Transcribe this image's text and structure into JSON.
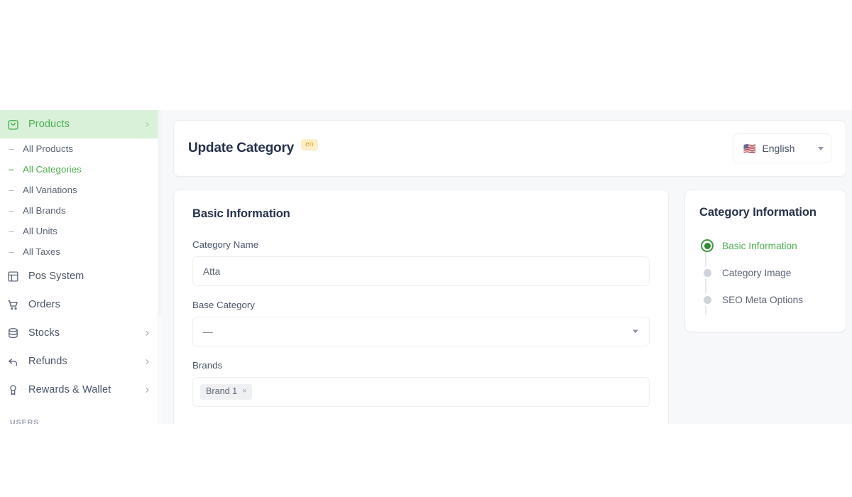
{
  "sidebar": {
    "groups": [
      {
        "label": "Products",
        "icon": "bag-icon",
        "active": true,
        "has_chevron": true,
        "children": [
          {
            "label": "All Products",
            "active": false
          },
          {
            "label": "All Categories",
            "active": true
          },
          {
            "label": "All Variations",
            "active": false
          },
          {
            "label": "All Brands",
            "active": false
          },
          {
            "label": "All Units",
            "active": false
          },
          {
            "label": "All Taxes",
            "active": false
          }
        ]
      },
      {
        "label": "Pos System",
        "icon": "layout-grid-icon",
        "active": false,
        "has_chevron": false,
        "children": []
      },
      {
        "label": "Orders",
        "icon": "cart-icon",
        "active": false,
        "has_chevron": false,
        "children": []
      },
      {
        "label": "Stocks",
        "icon": "database-icon",
        "active": false,
        "has_chevron": true,
        "children": []
      },
      {
        "label": "Refunds",
        "icon": "undo-arrow-icon",
        "active": false,
        "has_chevron": true,
        "children": []
      },
      {
        "label": "Rewards & Wallet",
        "icon": "award-icon",
        "active": false,
        "has_chevron": true,
        "children": []
      }
    ],
    "section_title": "USERS"
  },
  "header": {
    "title": "Update Category",
    "lang_badge": "en",
    "language_select": {
      "flag": "🇺🇸",
      "value": "English",
      "icon": "chevron-down-icon"
    }
  },
  "basic_information": {
    "heading": "Basic Information",
    "fields": {
      "category_name": {
        "label": "Category Name",
        "value": "Atta",
        "placeholder": "Category Name"
      },
      "base_category": {
        "label": "Base Category",
        "value": "—",
        "icon": "chevron-down-icon"
      },
      "brands": {
        "label": "Brands",
        "chips": [
          {
            "label": "Brand 1",
            "remove": "×"
          }
        ]
      }
    }
  },
  "category_information": {
    "heading": "Category Information",
    "steps": [
      {
        "label": "Basic Information",
        "active": true
      },
      {
        "label": "Category Image",
        "active": false
      },
      {
        "label": "SEO Meta Options",
        "active": false
      }
    ]
  },
  "colors": {
    "accent_green": "#4caf50",
    "active_nav_bg": "#d9f0d9",
    "badge_amber_bg": "#fdeec8",
    "badge_amber_text": "#e0a32e",
    "app_bg": "#f7f8fa",
    "text_dark": "#25314a",
    "text_muted": "#5d6575"
  }
}
